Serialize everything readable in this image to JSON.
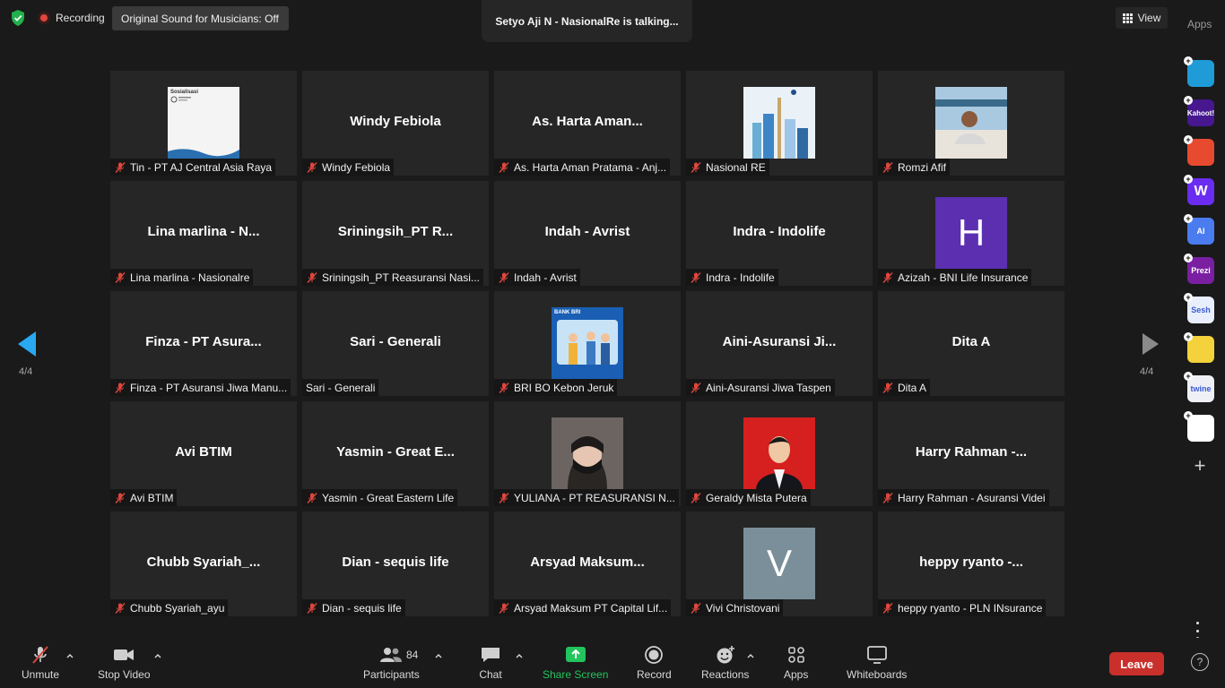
{
  "top_bar": {
    "recording_label": "Recording",
    "original_sound_label": "Original Sound for Musicians: Off",
    "talking_indicator": "Setyo Aji N - NasionalRe is talking...",
    "view_label": "View",
    "apps_label": "Apps"
  },
  "pagination": {
    "left_page": "4/4",
    "right_page": "4/4"
  },
  "tiles": [
    {
      "display": "",
      "label": "Tin - PT AJ Central Asia Raya",
      "image": "sosialisasi-image",
      "image_caption": "Sosialisasi"
    },
    {
      "display": "Windy Febiola",
      "label": "Windy Febiola"
    },
    {
      "display": "As. Harta Aman...",
      "label": "As. Harta Aman Pratama - Anj..."
    },
    {
      "display": "",
      "label": "Nasional RE",
      "image": "nasional-re-image"
    },
    {
      "display": "",
      "label": "Romzi Afif",
      "image": "profile-photo"
    },
    {
      "display": "Lina marlina - N...",
      "label": "Lina marlina - Nasionalre"
    },
    {
      "display": "Sriningsih_PT  R...",
      "label": "Sriningsih_PT Reasuransi Nasi..."
    },
    {
      "display": "Indah - Avrist",
      "label": "Indah - Avrist"
    },
    {
      "display": "Indra - Indolife",
      "label": "Indra - Indolife"
    },
    {
      "display": "",
      "label": "Azizah - BNI Life Insurance",
      "initial": "H",
      "initial_color": "#5b2fb0"
    },
    {
      "display": "Finza - PT Asura...",
      "label": "Finza - PT Asuransi Jiwa Manu..."
    },
    {
      "display": "Sari - Generali",
      "label": "Sari - Generali"
    },
    {
      "display": "",
      "label": "BRI BO Kebon Jeruk",
      "image": "bank-bri-image",
      "image_caption": "BANK BRI"
    },
    {
      "display": "Aini-Asuransi  Ji...",
      "label": "Aini-Asuransi Jiwa Taspen"
    },
    {
      "display": "Dita A",
      "label": "Dita A"
    },
    {
      "display": "Avi BTIM",
      "label": "Avi BTIM"
    },
    {
      "display": "Yasmin - Great E...",
      "label": "Yasmin - Great Eastern Life"
    },
    {
      "display": "",
      "label": "YULIANA - PT REASURANSI N...",
      "image": "masked-photo"
    },
    {
      "display": "",
      "label": "Geraldy Mista Putera",
      "image": "portrait-red-photo"
    },
    {
      "display": "Harry Rahman -...",
      "label": "Harry Rahman - Asuransi Videi"
    },
    {
      "display": "Chubb  Syariah_...",
      "label": "Chubb Syariah_ayu"
    },
    {
      "display": "Dian - sequis life",
      "label": "Dian - sequis life"
    },
    {
      "display": "Arsyad  Maksum...",
      "label": "Arsyad Maksum PT Capital Lif..."
    },
    {
      "display": "",
      "label": "Vivi Christovani",
      "initial": "V",
      "initial_color": "#7a8f99"
    },
    {
      "display": "heppy ryanto -...",
      "label": "heppy ryanto - PLN INsurance"
    }
  ],
  "rail_apps": [
    {
      "name": "arrow-app",
      "text": "",
      "color": "#1f9bd8"
    },
    {
      "name": "kahoot-app",
      "text": "Kahoot!",
      "color": "#46178f"
    },
    {
      "name": "red-app",
      "text": "",
      "color": "#e84a2f"
    },
    {
      "name": "wooclap-app",
      "text": "W",
      "color": "#6a2cf0"
    },
    {
      "name": "ai-app",
      "text": "AI",
      "color": "#4a7cf0"
    },
    {
      "name": "prezi-app",
      "text": "Prezi",
      "color": "#7a1fa2"
    },
    {
      "name": "sesh-app",
      "text": "Sesh",
      "color": "#e8eefc"
    },
    {
      "name": "emoji-app",
      "text": "",
      "color": "#f3d23b"
    },
    {
      "name": "twine-app",
      "text": "twine",
      "color": "#eef0f6"
    },
    {
      "name": "mosaic-app",
      "text": "",
      "color": "#ffffff"
    }
  ],
  "toolbar": {
    "unmute": "Unmute",
    "stop_video": "Stop Video",
    "participants": "Participants",
    "participants_count": "84",
    "chat": "Chat",
    "share_screen": "Share Screen",
    "record": "Record",
    "reactions": "Reactions",
    "apps": "Apps",
    "whiteboards": "Whiteboards",
    "leave": "Leave",
    "help": "?"
  },
  "colors": {
    "leave": "#c9302c",
    "share": "#21c45d",
    "nav_arrow": "#2aa8f0"
  }
}
